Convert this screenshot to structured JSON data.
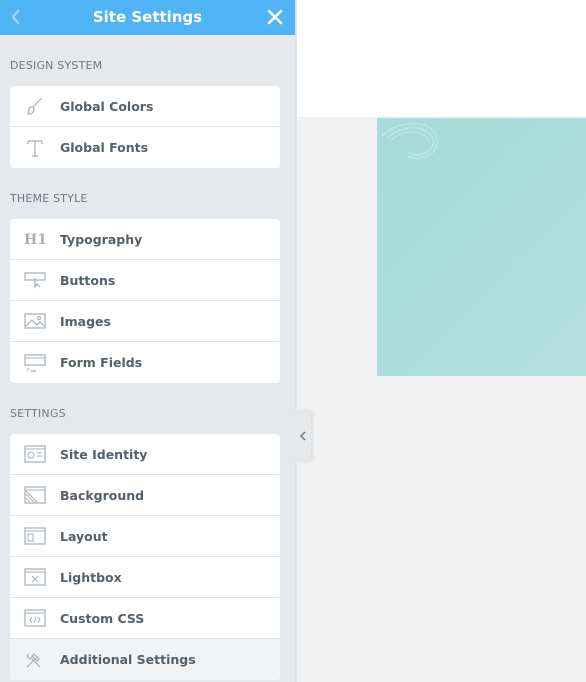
{
  "header": {
    "title": "Site Settings"
  },
  "sections": {
    "design_system": {
      "title": "DESIGN SYSTEM",
      "items": [
        {
          "label": "Global Colors",
          "icon": "brush-icon"
        },
        {
          "label": "Global Fonts",
          "icon": "type-icon"
        }
      ]
    },
    "theme_style": {
      "title": "THEME STYLE",
      "items": [
        {
          "label": "Typography",
          "icon": "heading-icon"
        },
        {
          "label": "Buttons",
          "icon": "button-icon"
        },
        {
          "label": "Images",
          "icon": "image-icon"
        },
        {
          "label": "Form Fields",
          "icon": "form-fields-icon"
        }
      ]
    },
    "settings": {
      "title": "SETTINGS",
      "items": [
        {
          "label": "Site Identity",
          "icon": "site-identity-icon"
        },
        {
          "label": "Background",
          "icon": "background-icon"
        },
        {
          "label": "Layout",
          "icon": "layout-icon"
        },
        {
          "label": "Lightbox",
          "icon": "lightbox-icon"
        },
        {
          "label": "Custom CSS",
          "icon": "code-icon"
        },
        {
          "label": "Additional Settings",
          "icon": "tools-icon"
        }
      ]
    }
  },
  "colors": {
    "header_bg": "#4fb3f4",
    "panel_bg": "#e6e9ec",
    "preview_teal": "#a6dcd9"
  }
}
